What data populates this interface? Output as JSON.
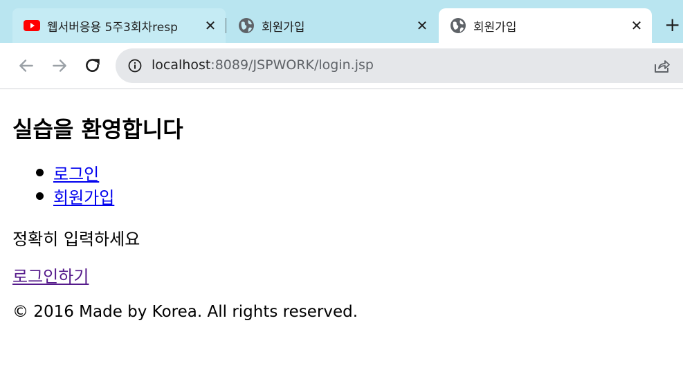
{
  "browser": {
    "tabs": [
      {
        "title": "웹서버응용 5주3회차resp",
        "favicon": "youtube-icon",
        "active": false
      },
      {
        "title": "회원가입",
        "favicon": "globe-icon",
        "active": false
      },
      {
        "title": "회원가입",
        "favicon": "globe-icon",
        "active": true
      }
    ],
    "close_glyph": "✕",
    "new_tab_glyph": "+",
    "url_host": "localhost",
    "url_rest": ":8089/JSPWORK/login.jsp",
    "colors": {
      "tab_strip": "#b9e5f0",
      "omnibox": "#e5e7ea",
      "youtube_red": "#ff0000"
    }
  },
  "page": {
    "heading": "실습을 환영합니다",
    "menu": [
      {
        "label": "로그인"
      },
      {
        "label": "회원가입"
      }
    ],
    "message": "정확히 입력하세요",
    "login_link": "로그인하기",
    "footer": "© 2016 Made by Korea. All rights reserved."
  }
}
